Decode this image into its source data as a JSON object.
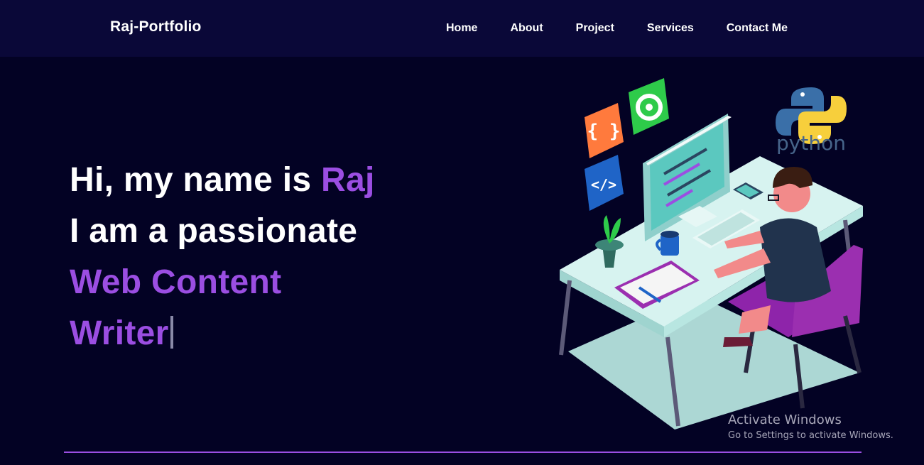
{
  "navbar": {
    "brand": "Raj-Portfolio",
    "links": [
      {
        "label": "Home"
      },
      {
        "label": "About"
      },
      {
        "label": "Project"
      },
      {
        "label": "Services"
      },
      {
        "label": "Contact Me"
      }
    ]
  },
  "hero": {
    "line1_prefix": "Hi, my name is ",
    "name": "Raj",
    "line2": "I am a passionate",
    "role_line1": "Web Content",
    "role_line2": "Writer"
  },
  "illustration": {
    "python_label": "python",
    "icon_left_top": "{ }",
    "icon_left_bottom": "</>"
  },
  "colors": {
    "background": "#030224",
    "navbar": "#0a0838",
    "accent": "#9b4ee2"
  },
  "watermark": {
    "title": "Activate Windows",
    "subtitle": "Go to Settings to activate Windows."
  }
}
